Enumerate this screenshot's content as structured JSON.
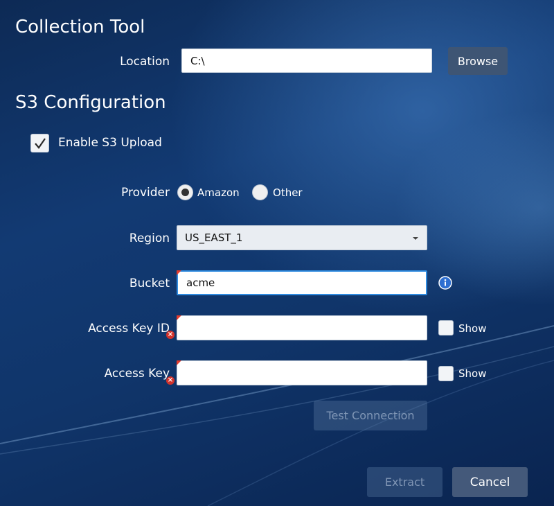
{
  "collection": {
    "heading": "Collection Tool",
    "location_label": "Location",
    "location_value": "C:\\",
    "browse_label": "Browse"
  },
  "s3": {
    "heading": "S3 Configuration",
    "enable_label": "Enable S3 Upload",
    "enable_checked": true,
    "provider_label": "Provider",
    "provider_options": [
      "Amazon",
      "Other"
    ],
    "provider_selected": "Amazon",
    "region_label": "Region",
    "region_value": "US_EAST_1",
    "bucket_label": "Bucket",
    "bucket_value": "acme",
    "access_key_id_label": "Access Key ID",
    "access_key_id_value": "",
    "access_key_label": "Access Key",
    "access_key_value": "",
    "show_label": "Show",
    "test_label": "Test Connection"
  },
  "footer": {
    "extract_label": "Extract",
    "cancel_label": "Cancel"
  },
  "icons": [
    "checkmark-icon",
    "dropdown-arrow-icon",
    "info-icon",
    "error-icon"
  ],
  "colors": {
    "background": "#123a73",
    "focus_border": "#2f8be0",
    "error": "#d2332c",
    "button": "#3e5574"
  }
}
